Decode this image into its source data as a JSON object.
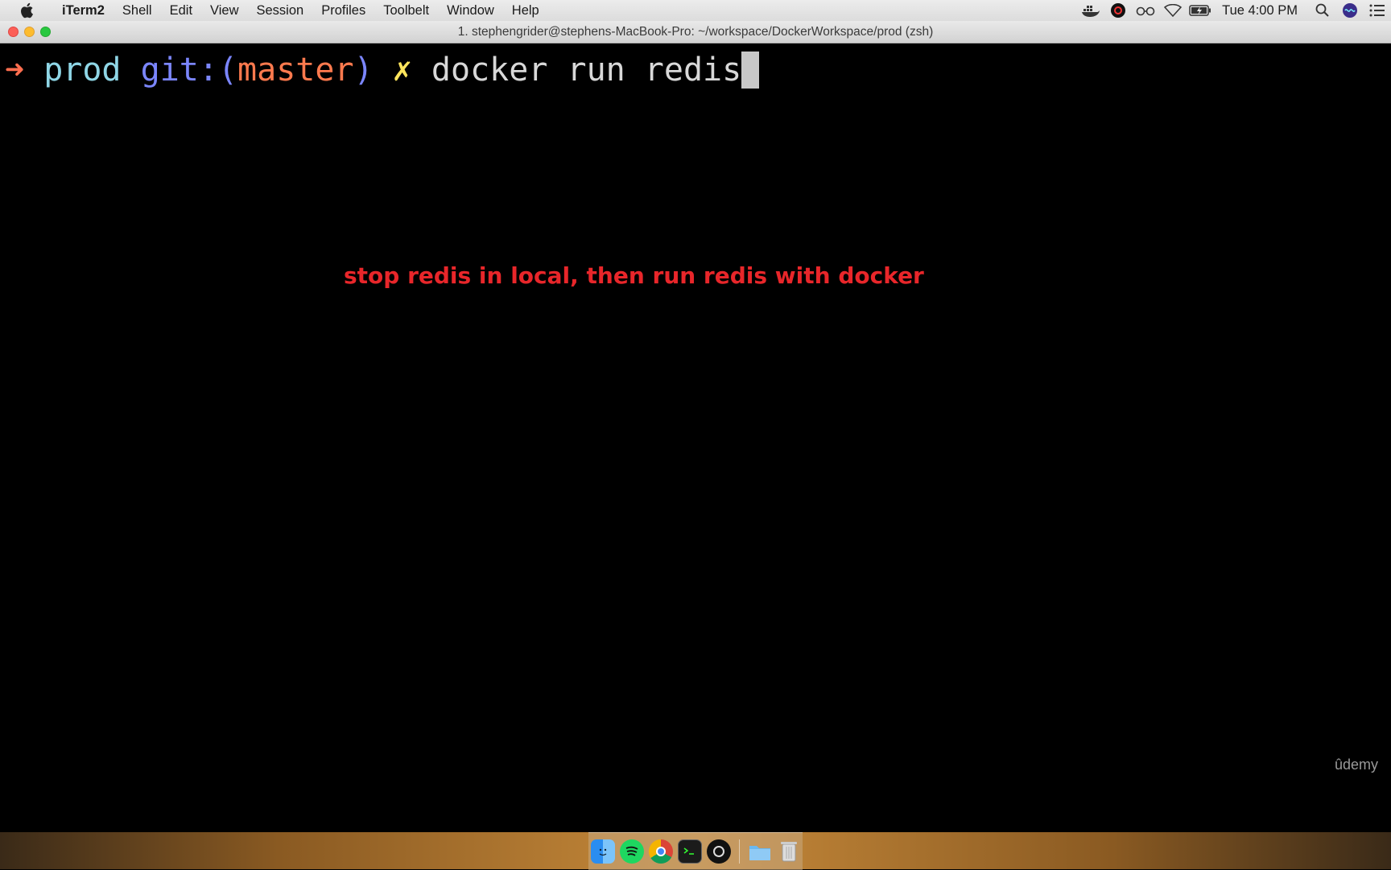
{
  "menubar": {
    "app_name": "iTerm2",
    "items": [
      "Shell",
      "Edit",
      "View",
      "Session",
      "Profiles",
      "Toolbelt",
      "Window",
      "Help"
    ],
    "clock": "Tue 4:00 PM",
    "status_icons": [
      "docker-icon",
      "obs-icon",
      "glasses-icon",
      "wifi-icon",
      "battery-icon"
    ]
  },
  "window": {
    "title": "1. stephengrider@stephens-MacBook-Pro: ~/workspace/DockerWorkspace/prod (zsh)"
  },
  "terminal": {
    "arrow": "➜",
    "dir": "prod",
    "git_prefix": "git:(",
    "branch": "master",
    "git_suffix": ")",
    "dirty_marker": "✗",
    "command": "docker run redis"
  },
  "annotation": "stop redis in local, then run redis with docker",
  "watermark": "ûdemy",
  "dock": {
    "apps": [
      "finder-icon",
      "spotify-icon",
      "chrome-icon",
      "terminal-icon",
      "obs-icon",
      "folder-icon",
      "trash-icon"
    ]
  },
  "colors": {
    "arrow": "#ff6e4f",
    "dir": "#8fd6e6",
    "git": "#7b86ff",
    "branch": "#ff7a4e",
    "dirty": "#ffe55c",
    "annotation": "#e8262a"
  }
}
